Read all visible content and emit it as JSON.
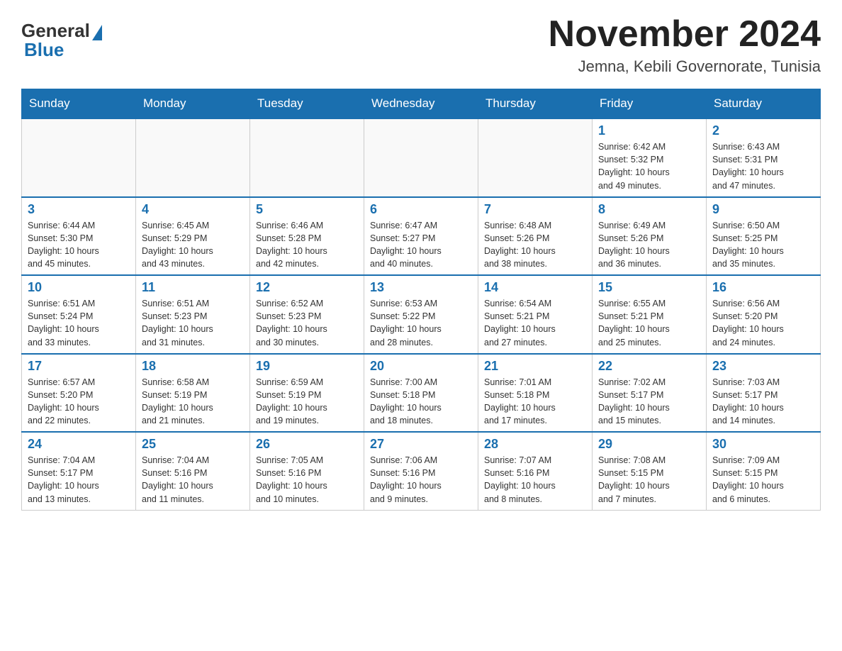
{
  "header": {
    "logo_general": "General",
    "logo_blue": "Blue",
    "month_title": "November 2024",
    "location": "Jemna, Kebili Governorate, Tunisia"
  },
  "weekdays": [
    "Sunday",
    "Monday",
    "Tuesday",
    "Wednesday",
    "Thursday",
    "Friday",
    "Saturday"
  ],
  "weeks": [
    [
      {
        "day": "",
        "info": ""
      },
      {
        "day": "",
        "info": ""
      },
      {
        "day": "",
        "info": ""
      },
      {
        "day": "",
        "info": ""
      },
      {
        "day": "",
        "info": ""
      },
      {
        "day": "1",
        "info": "Sunrise: 6:42 AM\nSunset: 5:32 PM\nDaylight: 10 hours\nand 49 minutes."
      },
      {
        "day": "2",
        "info": "Sunrise: 6:43 AM\nSunset: 5:31 PM\nDaylight: 10 hours\nand 47 minutes."
      }
    ],
    [
      {
        "day": "3",
        "info": "Sunrise: 6:44 AM\nSunset: 5:30 PM\nDaylight: 10 hours\nand 45 minutes."
      },
      {
        "day": "4",
        "info": "Sunrise: 6:45 AM\nSunset: 5:29 PM\nDaylight: 10 hours\nand 43 minutes."
      },
      {
        "day": "5",
        "info": "Sunrise: 6:46 AM\nSunset: 5:28 PM\nDaylight: 10 hours\nand 42 minutes."
      },
      {
        "day": "6",
        "info": "Sunrise: 6:47 AM\nSunset: 5:27 PM\nDaylight: 10 hours\nand 40 minutes."
      },
      {
        "day": "7",
        "info": "Sunrise: 6:48 AM\nSunset: 5:26 PM\nDaylight: 10 hours\nand 38 minutes."
      },
      {
        "day": "8",
        "info": "Sunrise: 6:49 AM\nSunset: 5:26 PM\nDaylight: 10 hours\nand 36 minutes."
      },
      {
        "day": "9",
        "info": "Sunrise: 6:50 AM\nSunset: 5:25 PM\nDaylight: 10 hours\nand 35 minutes."
      }
    ],
    [
      {
        "day": "10",
        "info": "Sunrise: 6:51 AM\nSunset: 5:24 PM\nDaylight: 10 hours\nand 33 minutes."
      },
      {
        "day": "11",
        "info": "Sunrise: 6:51 AM\nSunset: 5:23 PM\nDaylight: 10 hours\nand 31 minutes."
      },
      {
        "day": "12",
        "info": "Sunrise: 6:52 AM\nSunset: 5:23 PM\nDaylight: 10 hours\nand 30 minutes."
      },
      {
        "day": "13",
        "info": "Sunrise: 6:53 AM\nSunset: 5:22 PM\nDaylight: 10 hours\nand 28 minutes."
      },
      {
        "day": "14",
        "info": "Sunrise: 6:54 AM\nSunset: 5:21 PM\nDaylight: 10 hours\nand 27 minutes."
      },
      {
        "day": "15",
        "info": "Sunrise: 6:55 AM\nSunset: 5:21 PM\nDaylight: 10 hours\nand 25 minutes."
      },
      {
        "day": "16",
        "info": "Sunrise: 6:56 AM\nSunset: 5:20 PM\nDaylight: 10 hours\nand 24 minutes."
      }
    ],
    [
      {
        "day": "17",
        "info": "Sunrise: 6:57 AM\nSunset: 5:20 PM\nDaylight: 10 hours\nand 22 minutes."
      },
      {
        "day": "18",
        "info": "Sunrise: 6:58 AM\nSunset: 5:19 PM\nDaylight: 10 hours\nand 21 minutes."
      },
      {
        "day": "19",
        "info": "Sunrise: 6:59 AM\nSunset: 5:19 PM\nDaylight: 10 hours\nand 19 minutes."
      },
      {
        "day": "20",
        "info": "Sunrise: 7:00 AM\nSunset: 5:18 PM\nDaylight: 10 hours\nand 18 minutes."
      },
      {
        "day": "21",
        "info": "Sunrise: 7:01 AM\nSunset: 5:18 PM\nDaylight: 10 hours\nand 17 minutes."
      },
      {
        "day": "22",
        "info": "Sunrise: 7:02 AM\nSunset: 5:17 PM\nDaylight: 10 hours\nand 15 minutes."
      },
      {
        "day": "23",
        "info": "Sunrise: 7:03 AM\nSunset: 5:17 PM\nDaylight: 10 hours\nand 14 minutes."
      }
    ],
    [
      {
        "day": "24",
        "info": "Sunrise: 7:04 AM\nSunset: 5:17 PM\nDaylight: 10 hours\nand 13 minutes."
      },
      {
        "day": "25",
        "info": "Sunrise: 7:04 AM\nSunset: 5:16 PM\nDaylight: 10 hours\nand 11 minutes."
      },
      {
        "day": "26",
        "info": "Sunrise: 7:05 AM\nSunset: 5:16 PM\nDaylight: 10 hours\nand 10 minutes."
      },
      {
        "day": "27",
        "info": "Sunrise: 7:06 AM\nSunset: 5:16 PM\nDaylight: 10 hours\nand 9 minutes."
      },
      {
        "day": "28",
        "info": "Sunrise: 7:07 AM\nSunset: 5:16 PM\nDaylight: 10 hours\nand 8 minutes."
      },
      {
        "day": "29",
        "info": "Sunrise: 7:08 AM\nSunset: 5:15 PM\nDaylight: 10 hours\nand 7 minutes."
      },
      {
        "day": "30",
        "info": "Sunrise: 7:09 AM\nSunset: 5:15 PM\nDaylight: 10 hours\nand 6 minutes."
      }
    ]
  ],
  "colors": {
    "header_bg": "#1a6faf",
    "accent_blue": "#1a6faf"
  }
}
